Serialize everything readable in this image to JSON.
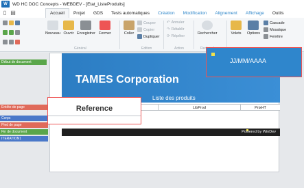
{
  "titlebar": {
    "logo": "W",
    "title": "WD HC DOC Concepts - WEBDEV - [Etat_ListeProduits]"
  },
  "quick_icons": [
    "new-doc-icon",
    "save-icon",
    "back-icon",
    "forward-icon"
  ],
  "tabs": [
    {
      "label": "Accueil",
      "active": true
    },
    {
      "label": "Projet"
    },
    {
      "label": "GDS"
    },
    {
      "label": "Tests automatiques"
    },
    {
      "label": "Création",
      "context": true
    },
    {
      "label": "Modification",
      "context": true
    },
    {
      "label": "Alignement",
      "context": true
    },
    {
      "label": "Affichage",
      "context": true
    },
    {
      "label": "Outils"
    }
  ],
  "ribbon": {
    "nouveau": "Nouveau",
    "ouvrir": "Ouvrir",
    "enregistrer": "Enregistrer",
    "fermer": "Fermer",
    "coller": "Coller",
    "couper": "Couper",
    "copier": "Copier",
    "dupliquer": "Dupliquer",
    "annuler": "Annuler",
    "retablir": "Rétablir",
    "repeter": "Répéter",
    "rechercher": "Rechercher",
    "volets": "Volets",
    "options": "Options",
    "cascade": "Cascade",
    "mosaique": "Mosaïque",
    "fenetre": "Fenêtre",
    "groups": {
      "general": "Général",
      "edition": "Edition",
      "action": "Action",
      "rechercher": "Rechercher"
    }
  },
  "sidebar_labels": [
    {
      "label": "Début de document",
      "color": "#5aa64a"
    },
    {
      "label": "Entête de page",
      "color": "#e06a5a"
    },
    {
      "label": "Corps",
      "color": "#4a78c9"
    },
    {
      "label": "Pied de page",
      "color": "#e06a5a"
    },
    {
      "label": "Fin de document",
      "color": "#5aa64a"
    },
    {
      "label": "ITERATION1",
      "color": "#4a78c9"
    }
  ],
  "report": {
    "company": "TAMES Corporation",
    "subtitle": "Liste des produits",
    "date_format": "JJ/MM/AAAA",
    "columns": [
      "LibProd",
      "PrixHT"
    ],
    "reference_label": "Reference",
    "footer": "Powered by WinDev"
  }
}
